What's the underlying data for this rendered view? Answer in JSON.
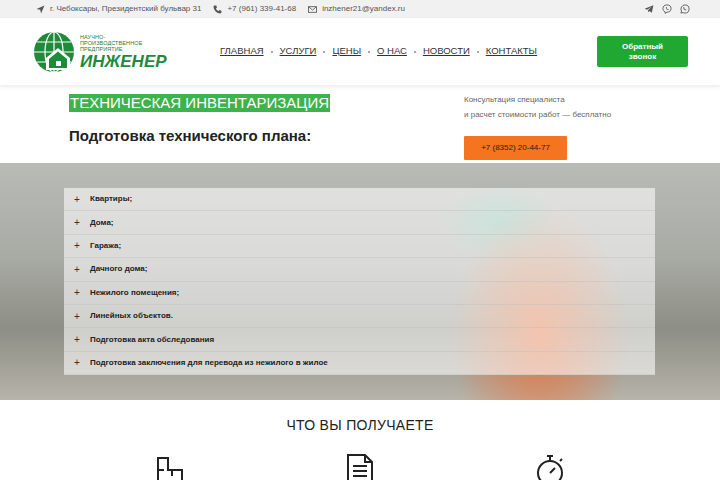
{
  "topbar": {
    "address": "г. Чебоксары, Президентский бульвар 31",
    "phone": "+7 (961) 339-41-68",
    "email": "inzhener21@yandex.ru"
  },
  "logo": {
    "line1": "НАУЧНО-",
    "line2": "ПРОИЗВОДСТВЕННОЕ",
    "line3": "ПРЕДПРИЯТИЕ",
    "name": "ИНЖЕНЕР"
  },
  "nav": [
    "ГЛАВНАЯ",
    "УСЛУГИ",
    "ЦЕНЫ",
    "О НАС",
    "НОВОСТИ",
    "КОНТАКТЫ"
  ],
  "callback_button": "Обратный звонок",
  "hero": {
    "title": "ТЕХНИЧЕСКАЯ ИНВЕНТАРИЗАЦИЯ",
    "subtitle": "Подготовка технического плана:",
    "consult_line1": "Консультация специалиста",
    "consult_line2": "и расчет стоимости работ — бесплатно",
    "phone_button": "+7 (8352) 20-44-77"
  },
  "services": [
    {
      "label": "Квартиры;",
      "toggle": "+",
      "expanded": false
    },
    {
      "label": "Дома;",
      "toggle": "+",
      "expanded": false
    },
    {
      "label": "Гаража;",
      "toggle": "+",
      "expanded": false
    },
    {
      "label": "Дачного дома;",
      "toggle": "+",
      "expanded": false
    },
    {
      "label": "Нежилого помещения;",
      "toggle": "+",
      "expanded": false
    },
    {
      "label": "Линейных объектов.",
      "toggle": "+",
      "expanded": false
    },
    {
      "label": "Подготовка акта обследования",
      "toggle": "+",
      "expanded": false
    },
    {
      "label": "Подготовка заключения для перевода из нежилого в жилое",
      "toggle": "+",
      "expanded": false
    }
  ],
  "benefits": {
    "title": "ЧТО ВЫ ПОЛУЧАЕТЕ"
  }
}
